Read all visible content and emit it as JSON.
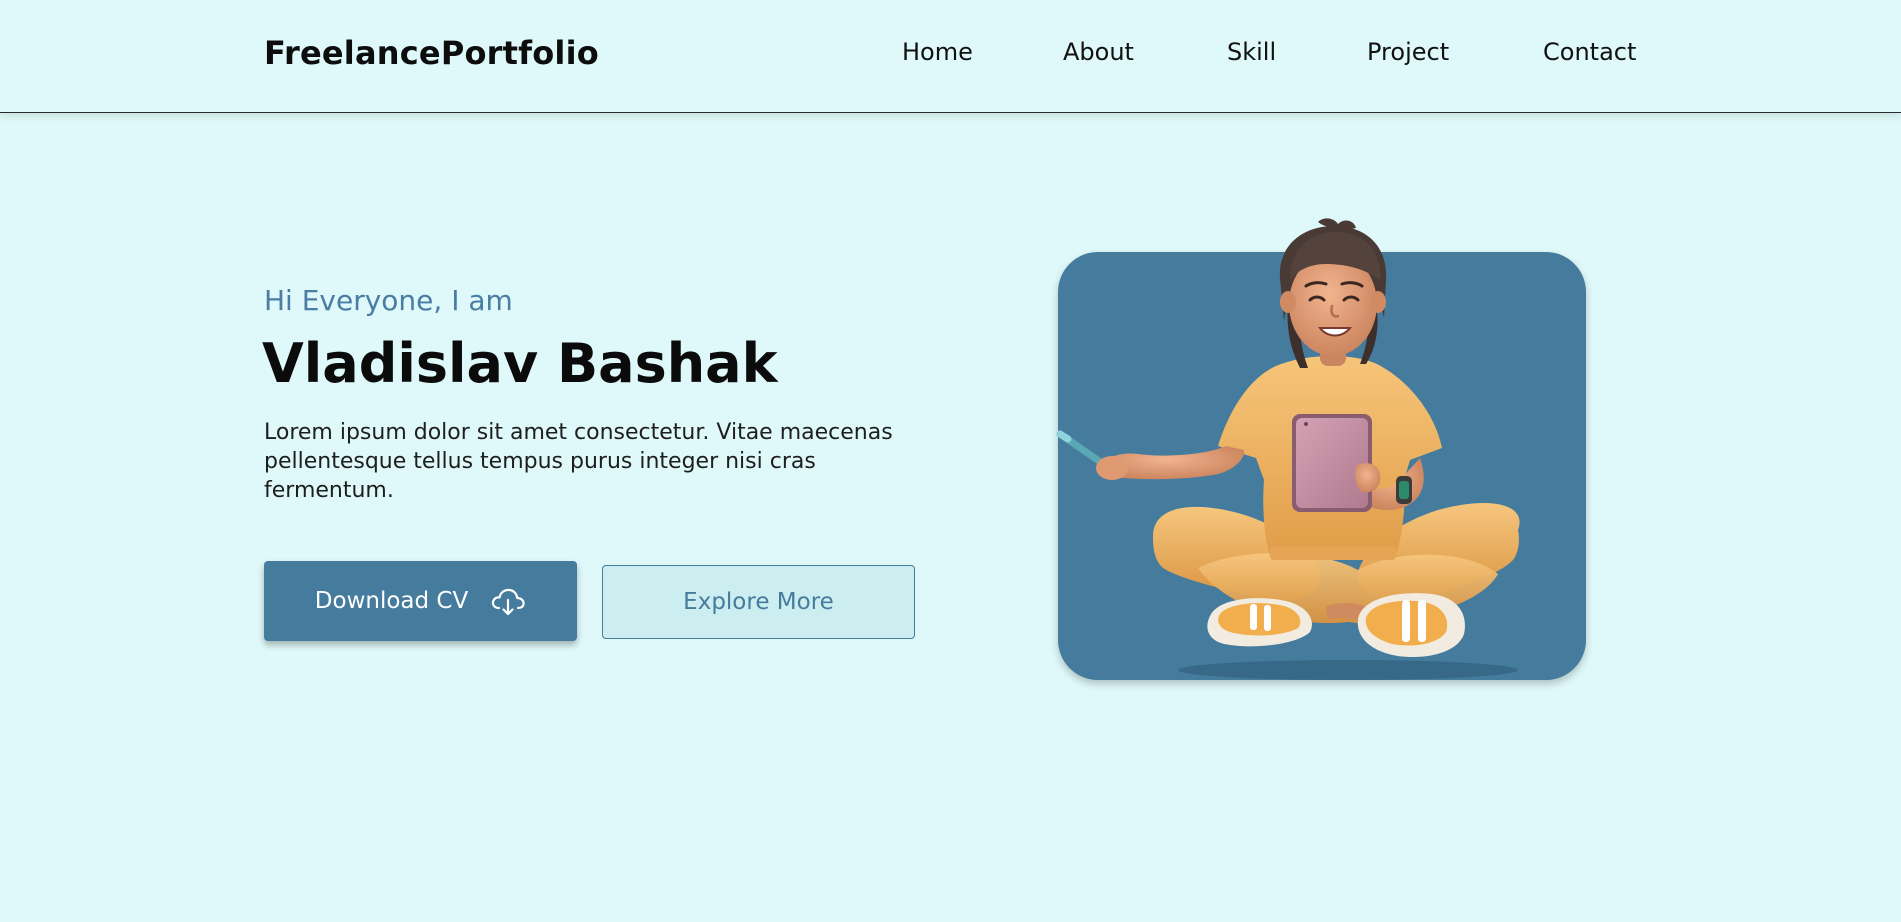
{
  "header": {
    "logo": "FreelancePortfolio",
    "nav": [
      {
        "label": "Home"
      },
      {
        "label": "About"
      },
      {
        "label": "Skill"
      },
      {
        "label": "Project"
      },
      {
        "label": "Contact"
      }
    ]
  },
  "hero": {
    "greeting": "Hi Everyone, I am",
    "name": "Vladislav Bashak",
    "intro": "Lorem ipsum dolor sit amet consectetur. Vitae maecenas pellentesque tellus tempus purus integer nisi cras fermentum.",
    "download_label": "Download CV",
    "download_icon": "cloud-download-icon",
    "explore_label": "Explore More",
    "illustration": "3d-character-sitting-with-tablet"
  },
  "colors": {
    "background": "#dff8f9",
    "accent": "#457b9d",
    "secondary_button_bg": "#cdeef1",
    "text": "#0d0d0d",
    "character_outfit": "#f0b45e"
  }
}
